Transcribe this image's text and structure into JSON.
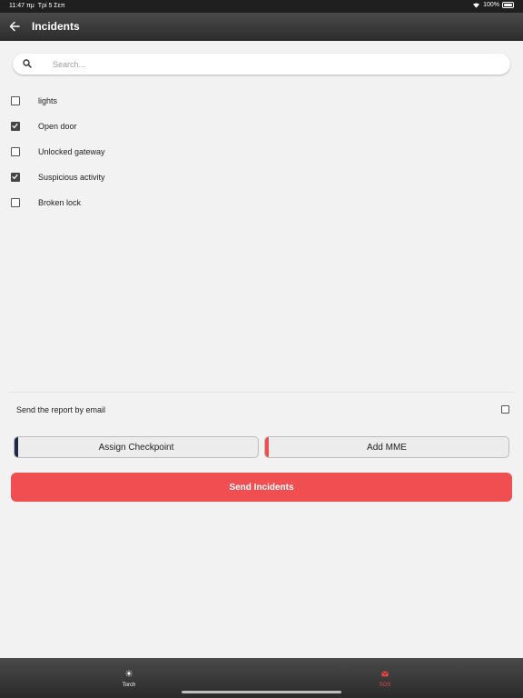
{
  "status": {
    "time": "11:47 πμ",
    "date": "Τρί 5 Σεπ",
    "battery": "100%"
  },
  "header": {
    "title": "Incidents"
  },
  "search": {
    "placeholder": "Search..."
  },
  "incidents": [
    {
      "label": "lights",
      "checked": false
    },
    {
      "label": "Open door",
      "checked": true
    },
    {
      "label": "Unlocked gateway",
      "checked": false
    },
    {
      "label": "Suspicious activity",
      "checked": true
    },
    {
      "label": "Broken lock",
      "checked": false
    }
  ],
  "email": {
    "label": "Send the report by email",
    "checked": false
  },
  "buttons": {
    "assign_checkpoint": "Assign Checkpoint",
    "add_mme": "Add MME",
    "send_incidents": "Send Incidents"
  },
  "colors": {
    "primary_red": "#ef4f50",
    "navy_accent": "#1c2a48",
    "red_accent": "#ef4f50"
  },
  "tabs": [
    {
      "label": "Torch",
      "icon": "sun-icon",
      "active": false
    },
    {
      "label": "SOS",
      "icon": "envelope-icon",
      "active": true
    }
  ]
}
